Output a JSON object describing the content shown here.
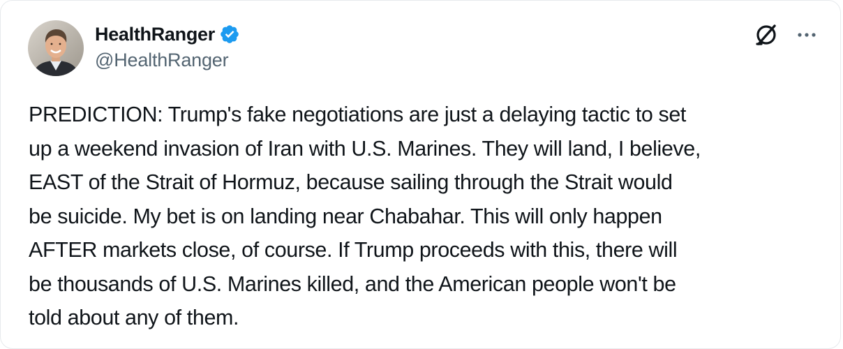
{
  "post": {
    "author": {
      "display_name": "HealthRanger",
      "handle": "@HealthRanger",
      "verified": true,
      "verified_badge_color": "#1d9bf0"
    },
    "header_actions": {
      "grok_icon": "grok-icon",
      "more_icon": "more-options-icon"
    },
    "text": "PREDICTION: Trump's fake negotiations are just a delaying tactic to set\nup a weekend invasion of Iran with U.S. Marines. They will land, I believe,\nEAST of the Strait of Hormuz, because sailing through the Strait would\nbe suicide. My bet is on landing near Chabahar. This will only happen\nAFTER markets close, of course. If Trump proceeds with this, there will\nbe thousands of U.S. Marines killed, and the American people won't be\ntold about any of them."
  },
  "colors": {
    "text_primary": "#0f1419",
    "text_secondary": "#536471",
    "border": "#e6e9ec"
  }
}
